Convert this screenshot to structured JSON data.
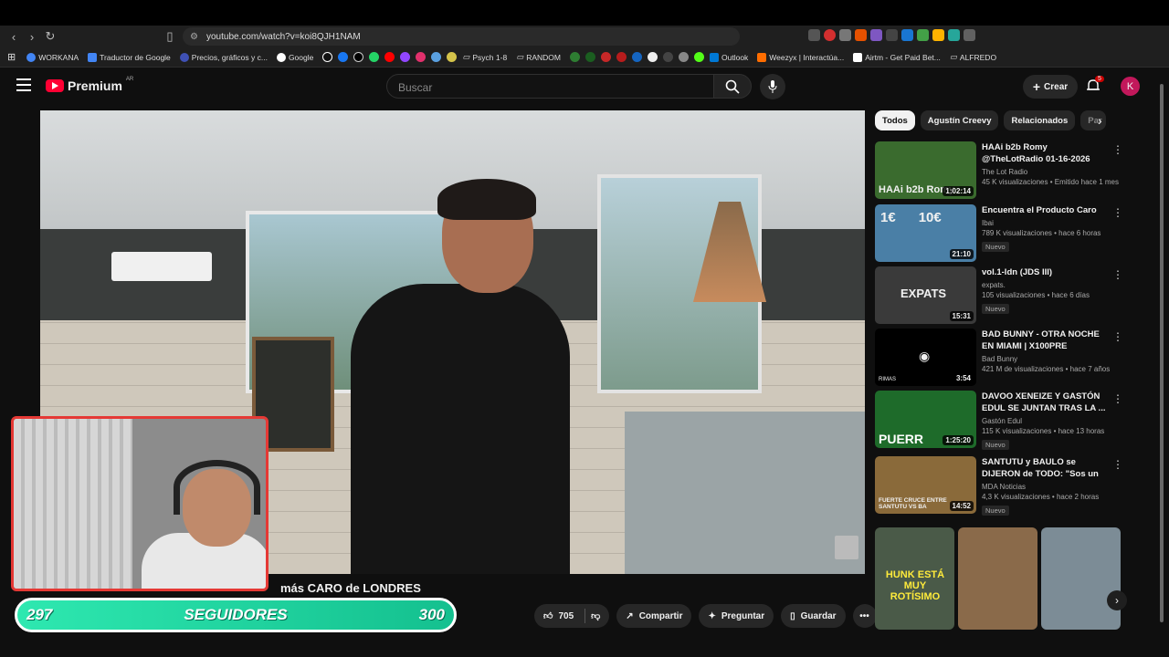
{
  "browser": {
    "url": "youtube.com/watch?v=koi8QJH1NAM",
    "bookmarks": [
      "WORKANA",
      "Traductor de Google",
      "Precios, gráficos y c...",
      "Google",
      "Psych 1-8",
      "RANDOM",
      "Outlook",
      "Weezyx | Interactúa...",
      "Airtm - Get Paid Bet...",
      "ALFREDO"
    ]
  },
  "header": {
    "logo": "Premium",
    "region": "AR",
    "search_placeholder": "Buscar",
    "create_label": "Crear",
    "notif_count": "5",
    "avatar_letter": "K"
  },
  "video": {
    "title_visible": "más CARO de LONDRES"
  },
  "overlay": {
    "followers_current": "297",
    "followers_label": "SEGUIDORES",
    "followers_goal": "300"
  },
  "actions": {
    "likes": "705",
    "share": "Compartir",
    "ask": "Preguntar",
    "save": "Guardar"
  },
  "chips": [
    "Todos",
    "Agustín Creevy",
    "Relacionados",
    "Par"
  ],
  "recommendations": [
    {
      "title": "HAAi b2b Romy @TheLotRadio 01-16-2026",
      "channel": "The Lot Radio",
      "meta": "45 K visualizaciones • Emitido hace 1 mes",
      "duration": "1:02:14",
      "badge": "",
      "thumb_text": "HAAi b2b Romy",
      "color": "#3a6b2e"
    },
    {
      "title": "Encuentra el Producto Caro",
      "channel": "Ibai",
      "meta": "789 K visualizaciones • hace 6 horas",
      "duration": "21:10",
      "badge": "Nuevo",
      "thumb_text": "1€      10€",
      "color": "#4a7fa6"
    },
    {
      "title": "vol.1-ldn (JDS III)",
      "channel": "expats.",
      "meta": "105 visualizaciones • hace 6 días",
      "duration": "15:31",
      "badge": "Nuevo",
      "thumb_text": "EXPATS",
      "color": "#3a3a3a"
    },
    {
      "title": "BAD BUNNY - OTRA NOCHE EN MIAMI | X100PRE [Visualizer]",
      "channel": "Bad Bunny",
      "meta": "421 M de visualizaciones • hace 7 años",
      "duration": "3:54",
      "badge": "",
      "thumb_text": "RIMAS",
      "color": "#000000"
    },
    {
      "title": "DAVOO XENEIZE Y GASTÓN EDUL SE JUNTAN TRAS LA ...",
      "channel": "Gastón Edul",
      "meta": "115 K visualizaciones • hace 13 horas",
      "duration": "1:25:20",
      "badge": "Nuevo",
      "thumb_text": "PUERR",
      "color": "#1e6b2a"
    },
    {
      "title": "SANTUTU y BAULO se DIJERON de TODO: \"Sos un SOBERBIO\"",
      "channel": "MDA Noticias",
      "meta": "4,3 K visualizaciones • hace 2 horas",
      "duration": "14:52",
      "badge": "Nuevo",
      "thumb_text": "FUERTE CRUCE ENTRE SANTUTU VS BA",
      "color": "#8a6a3a"
    }
  ],
  "shorts": [
    {
      "text": "HUNK ESTÁ MUY ROTÍSIMO",
      "color": "#4a5a48"
    },
    {
      "text": "",
      "color": "#8a6a4a"
    },
    {
      "text": "",
      "color": "#7c8c96"
    }
  ]
}
